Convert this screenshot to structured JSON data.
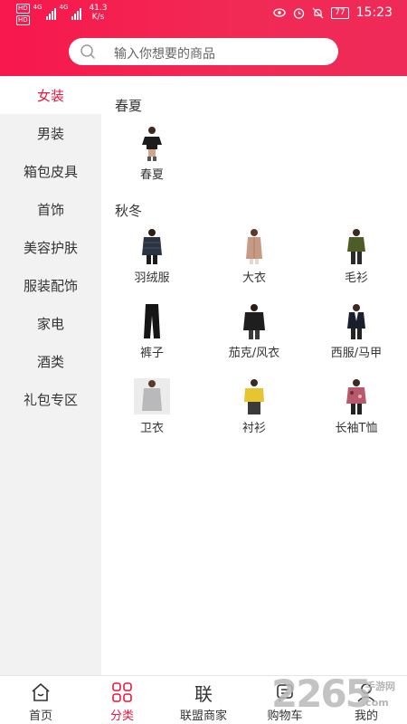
{
  "status_bar": {
    "net_badge_1": "HD",
    "net_badge_2": "HD",
    "net_gen_1": "4G",
    "net_gen_2": "4G",
    "speed_value": "41.3",
    "speed_unit": "K/s",
    "battery": "77",
    "time": "15:23"
  },
  "search": {
    "placeholder": "输入你想要的商品"
  },
  "sidebar": {
    "items": [
      {
        "label": "女装",
        "active": true
      },
      {
        "label": "男装"
      },
      {
        "label": "箱包皮具"
      },
      {
        "label": "首饰"
      },
      {
        "label": "美容护肤"
      },
      {
        "label": "服装配饰"
      },
      {
        "label": "家电"
      },
      {
        "label": "酒类"
      },
      {
        "label": "礼包专区"
      }
    ]
  },
  "sections": [
    {
      "title": "春夏",
      "products": [
        {
          "label": "春夏",
          "icon": "black-tshirt-icon"
        }
      ]
    },
    {
      "title": "秋冬",
      "products": [
        {
          "label": "羽绒服",
          "icon": "down-jacket-icon"
        },
        {
          "label": "大衣",
          "icon": "coat-icon"
        },
        {
          "label": "毛衫",
          "icon": "sweater-icon"
        },
        {
          "label": "裤子",
          "icon": "pants-icon"
        },
        {
          "label": "茄克/风衣",
          "icon": "jacket-icon"
        },
        {
          "label": "西服/马甲",
          "icon": "blazer-icon"
        },
        {
          "label": "卫衣",
          "icon": "hoodie-icon"
        },
        {
          "label": "衬衫",
          "icon": "shirt-icon"
        },
        {
          "label": "长袖T恤",
          "icon": "long-sleeve-tee-icon"
        }
      ]
    }
  ],
  "bottom_nav": {
    "items": [
      {
        "label": "首页",
        "icon": "home-icon"
      },
      {
        "label": "分类",
        "icon": "category-grid-icon",
        "active": true
      },
      {
        "label": "联盟商家",
        "icon_text": "联"
      },
      {
        "label": "购物车",
        "icon": "cart-icon"
      },
      {
        "label": "我的",
        "icon": "user-icon"
      }
    ]
  },
  "watermark": {
    "number": "2265",
    "cn": "手游网",
    "domain": ".com"
  },
  "colors": {
    "accent": "#e8173f",
    "header_start": "#f7174c",
    "header_end": "#ef2a58",
    "sidebar_bg": "#f2f2f2"
  }
}
